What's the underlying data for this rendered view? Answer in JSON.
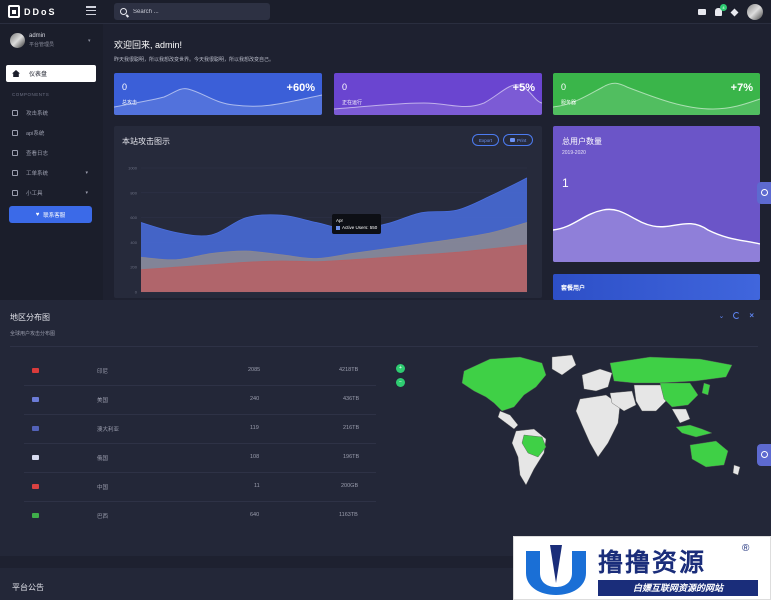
{
  "brand": {
    "name": "DDoS"
  },
  "search": {
    "placeholder": "Search ..."
  },
  "notifications": {
    "count": "4"
  },
  "user": {
    "name": "admin",
    "role": "平台管理员"
  },
  "sidebar": {
    "active": "仪表盘",
    "section": "COMPONENTS",
    "items": [
      {
        "label": "攻击系统",
        "icon": "chart-icon"
      },
      {
        "label": "api系统",
        "icon": "code-icon"
      },
      {
        "label": "查看日志",
        "icon": "log-icon"
      },
      {
        "label": "工单系统",
        "icon": "ticket-icon",
        "caret": true
      },
      {
        "label": "小工具",
        "icon": "monitor-icon",
        "caret": true
      }
    ],
    "contact": "联系客服"
  },
  "welcome": {
    "title": "欢迎回来, admin!",
    "subtitle": "昨天我很聪明，所以我想改变世界。今天我很聪明，所以我想改变自己。"
  },
  "stats": [
    {
      "value": "0",
      "label": "总攻击",
      "percent": "+60%",
      "color": "#3b5fd8"
    },
    {
      "value": "0",
      "label": "正在运行",
      "percent": "+5%",
      "color": "#6a45d0"
    },
    {
      "value": "0",
      "label": "服务器",
      "percent": "+7%",
      "color": "#3ab54a"
    }
  ],
  "attack_chart": {
    "title": "本站攻击图示",
    "export_label": "Export",
    "print_label": "Print",
    "tooltip_title": "Apr",
    "tooltip_value": "Active Users: 550",
    "y_ticks": [
      "1000",
      "800",
      "600",
      "400",
      "200",
      "0"
    ]
  },
  "chart_data": {
    "type": "area",
    "x": [
      1,
      2,
      3,
      4,
      5,
      6,
      7,
      8,
      9,
      10,
      11,
      12
    ],
    "ylim": [
      0,
      1000
    ],
    "series": [
      {
        "name": "Active Users",
        "color": "#4a6fe0",
        "values": [
          560,
          480,
          460,
          600,
          620,
          560,
          500,
          550,
          640,
          660,
          780,
          920
        ]
      },
      {
        "color": "#8a8791",
        "values": [
          280,
          260,
          310,
          330,
          300,
          270,
          310,
          350,
          390,
          430,
          480,
          560
        ]
      },
      {
        "color": "#b56266",
        "values": [
          180,
          200,
          220,
          240,
          250,
          245,
          260,
          280,
          300,
          320,
          350,
          380
        ]
      }
    ]
  },
  "users": {
    "title": "总用户数量",
    "subtitle": "2019-2020",
    "value": "1"
  },
  "vip": {
    "title": "套餐用户"
  },
  "region": {
    "title": "地区分布图",
    "subtitle": "全球用户攻击分布图",
    "rows": [
      {
        "country": "印尼",
        "count": "2085",
        "traffic": "4218TB",
        "flag": "#d93b3b"
      },
      {
        "country": "美国",
        "count": "240",
        "traffic": "436TB",
        "flag": "#6b7bd6"
      },
      {
        "country": "澳大利亚",
        "count": "119",
        "traffic": "216TB",
        "flag": "#5362b8"
      },
      {
        "country": "俄国",
        "count": "108",
        "traffic": "196TB",
        "flag": "#d7dbf0"
      },
      {
        "country": "中国",
        "count": "11",
        "traffic": "200GB",
        "flag": "#d94141"
      },
      {
        "country": "巴西",
        "count": "640",
        "traffic": "1163TB",
        "flag": "#3fae4a"
      }
    ],
    "zoom_in": "+",
    "zoom_out": "−"
  },
  "announcement": {
    "title": "平台公告"
  },
  "watermark": {
    "title": "撸撸资源",
    "reg": "®",
    "subtitle": "白嫖互联网资源的网站"
  }
}
